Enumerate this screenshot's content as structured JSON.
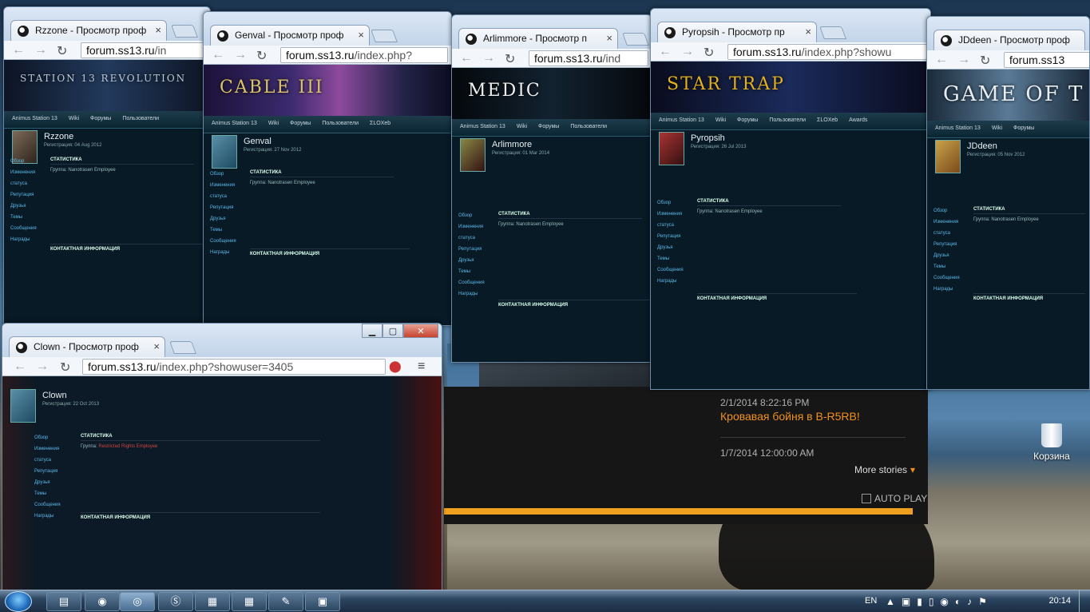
{
  "desktop": {
    "recycle_bin": "Корзина"
  },
  "windows": [
    {
      "tab_title": "Rzzone - Просмотр проф",
      "url_host": "forum.ss13.ru",
      "url_path": "/in",
      "banner": "STATION 13 REVOLUTION",
      "user": "Rzzone",
      "reg": "Регистрация: 04 Aug 2012"
    },
    {
      "tab_title": "Genval - Просмотр проф",
      "url_host": "forum.ss13.ru",
      "url_path": "/index.php?",
      "banner": "CABLE III",
      "user": "Genval",
      "reg": "Регистрация: 27 Nov 2012"
    },
    {
      "tab_title": "Arlimmore - Просмотр п",
      "url_host": "forum.ss13.ru",
      "url_path": "/ind",
      "banner": "MEDIC",
      "user": "Arlimmore",
      "reg": "Регистрация: 01 Mar 2014"
    },
    {
      "tab_title": "Pyropsih - Просмотр пр",
      "url_host": "forum.ss13.ru",
      "url_path": "/index.php?showu",
      "banner": "STAR TRAP",
      "user": "Pyropsih",
      "reg": "Регистрация: 26 Jul 2013"
    },
    {
      "tab_title": "JDdeen - Просмотр проф",
      "url_host": "forum.ss13",
      "url_path": "",
      "banner": "GAME OF T",
      "user": "JDdeen",
      "reg": "Регистрация: 05 Nov 2012"
    },
    {
      "tab_title": "Clown - Просмотр проф",
      "url_host": "forum.ss13.ru",
      "url_path": "/index.php?showuser=3405",
      "banner": "",
      "user": "Clown",
      "reg": "Регистрация: 22 Oct 2013"
    }
  ],
  "forum": {
    "nav": [
      "Animus Station 13",
      "Wiki",
      "Форумы",
      "Пользователи",
      "ΣLOXeb",
      "Awards"
    ],
    "stats_title": "СТАТИСТИКА",
    "contact_title": "КОНТАКТНАЯ ИНФОРМАЦИЯ",
    "side": [
      "Обзор",
      "Изменения статуса",
      "Репутация",
      "Друзья",
      "Темы",
      "Сообщения",
      "Награды"
    ],
    "group_label": "Группа:",
    "group_value": "Nanotrasen Employee"
  },
  "media": {
    "time1": "2/1/2014 8:22:16 PM",
    "headline": "Кровавая бойня в B-R5RB!",
    "time2": "1/7/2014 12:00:00 AM",
    "more": "More stories",
    "autoplay": "AUTO PLAY"
  },
  "taskbar": {
    "lang": "EN",
    "clock": "20:14"
  }
}
